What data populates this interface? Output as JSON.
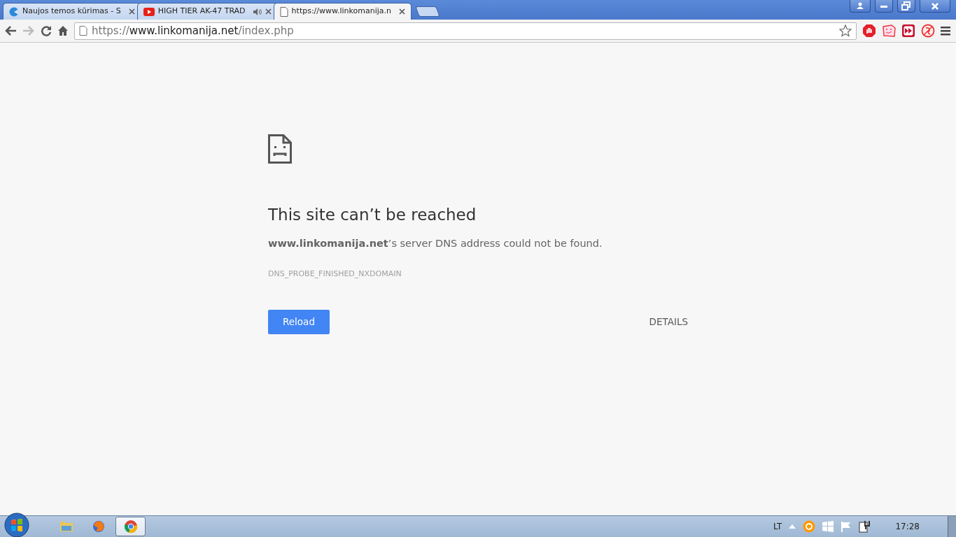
{
  "tabs": [
    {
      "title": "Naujos temos kūrimas - S",
      "kind": "pacman",
      "audio": false,
      "selected": false
    },
    {
      "title": "HIGH TIER AK-47 TRAD",
      "kind": "video",
      "audio": true,
      "selected": false
    },
    {
      "title": "https://www.linkomanija.n",
      "kind": "page",
      "audio": false,
      "selected": true
    }
  ],
  "toolbar": {
    "forward_disabled": true,
    "address": {
      "scheme": "https://",
      "host": "www.linkomanija.net",
      "path": "/index.php"
    },
    "bookmarked": false
  },
  "error_page": {
    "heading": "This site can’t be reached",
    "message": "**www.linkomanija.net**’s server DNS address could not be found.",
    "code": "DNS_PROBE_FINISHED_NXDOMAIN",
    "primary_button": "Reload",
    "secondary_button": "DETAILS"
  },
  "taskbar": {
    "apps": [
      {
        "kind": "explorer",
        "selected": false
      },
      {
        "kind": "firefox",
        "selected": false
      },
      {
        "kind": "chrome",
        "selected": true
      }
    ],
    "language": "LT",
    "clock": "17:28"
  }
}
